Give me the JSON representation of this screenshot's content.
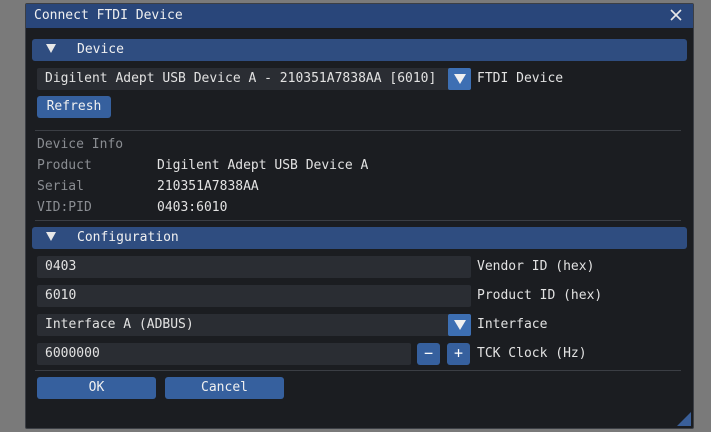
{
  "window": {
    "title": "Connect FTDI Device"
  },
  "device_section": {
    "header": "Device",
    "selected_device": "Digilent Adept USB Device A - 210351A7838AA [6010]",
    "combo_label": "FTDI Device",
    "refresh_label": "Refresh"
  },
  "device_info": {
    "title": "Device Info",
    "rows": [
      {
        "key": "Product",
        "value": "Digilent Adept USB Device A"
      },
      {
        "key": "Serial",
        "value": "210351A7838AA"
      },
      {
        "key": "VID:PID",
        "value": "0403:6010"
      }
    ]
  },
  "configuration": {
    "header": "Configuration",
    "vendor_id": {
      "value": "0403",
      "label": "Vendor ID (hex)"
    },
    "product_id": {
      "value": "6010",
      "label": "Product ID (hex)"
    },
    "interface": {
      "value": "Interface A (ADBUS)",
      "label": "Interface"
    },
    "tck_clock": {
      "value": "6000000",
      "label": "TCK Clock (Hz)",
      "minus": "−",
      "plus": "+"
    }
  },
  "footer": {
    "ok_label": "OK",
    "cancel_label": "Cancel"
  },
  "colors": {
    "title_bar": "#29467a",
    "header": "#2f4d80",
    "button": "#36609e",
    "combo_button": "#3d6fb3"
  }
}
